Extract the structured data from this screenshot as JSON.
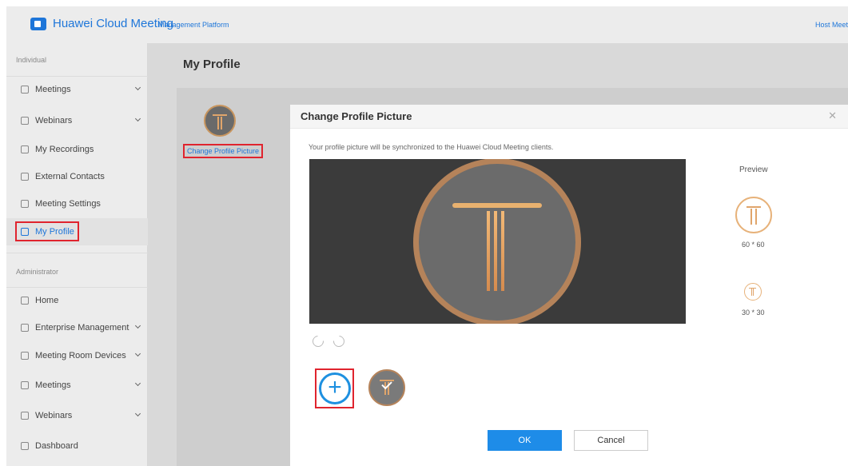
{
  "header": {
    "app_title": "Huawei Cloud Meeting",
    "app_subtitle": "Management Platform",
    "host_link": "Host Meet"
  },
  "sidebar": {
    "section_individual": "Individual",
    "section_administrator": "Administrator",
    "individual_items": [
      {
        "label": "Meetings",
        "icon": "calendar-icon",
        "expandable": true
      },
      {
        "label": "Webinars",
        "icon": "webinar-icon",
        "expandable": true
      },
      {
        "label": "My Recordings",
        "icon": "recording-icon",
        "expandable": false
      },
      {
        "label": "External Contacts",
        "icon": "contacts-icon",
        "expandable": false
      },
      {
        "label": "Meeting Settings",
        "icon": "settings-icon",
        "expandable": false
      },
      {
        "label": "My Profile",
        "icon": "user-icon",
        "expandable": false,
        "active": true
      }
    ],
    "admin_items": [
      {
        "label": "Home",
        "icon": "home-icon",
        "expandable": false
      },
      {
        "label": "Enterprise Management",
        "icon": "enterprise-icon",
        "expandable": true
      },
      {
        "label": "Meeting Room Devices",
        "icon": "device-icon",
        "expandable": true
      },
      {
        "label": "Meetings",
        "icon": "globe-icon",
        "expandable": true
      },
      {
        "label": "Webinars",
        "icon": "webinar-icon",
        "expandable": true
      },
      {
        "label": "Dashboard",
        "icon": "dashboard-icon",
        "expandable": false
      }
    ]
  },
  "main": {
    "page_title": "My Profile",
    "change_picture_link": "Change Profile Picture"
  },
  "modal": {
    "title": "Change Profile Picture",
    "close_icon": "✕",
    "description": "Your profile picture will be synchronized to the Huawei Cloud Meeting clients.",
    "preview_label": "Preview",
    "preview_large_size": "60 * 60",
    "preview_small_size": "30 * 30",
    "add_symbol": "+",
    "ok_label": "OK",
    "cancel_label": "Cancel"
  },
  "colors": {
    "accent": "#1e76d9",
    "highlight_box": "#e0242e",
    "avatar_gold": "#e0a56b"
  }
}
